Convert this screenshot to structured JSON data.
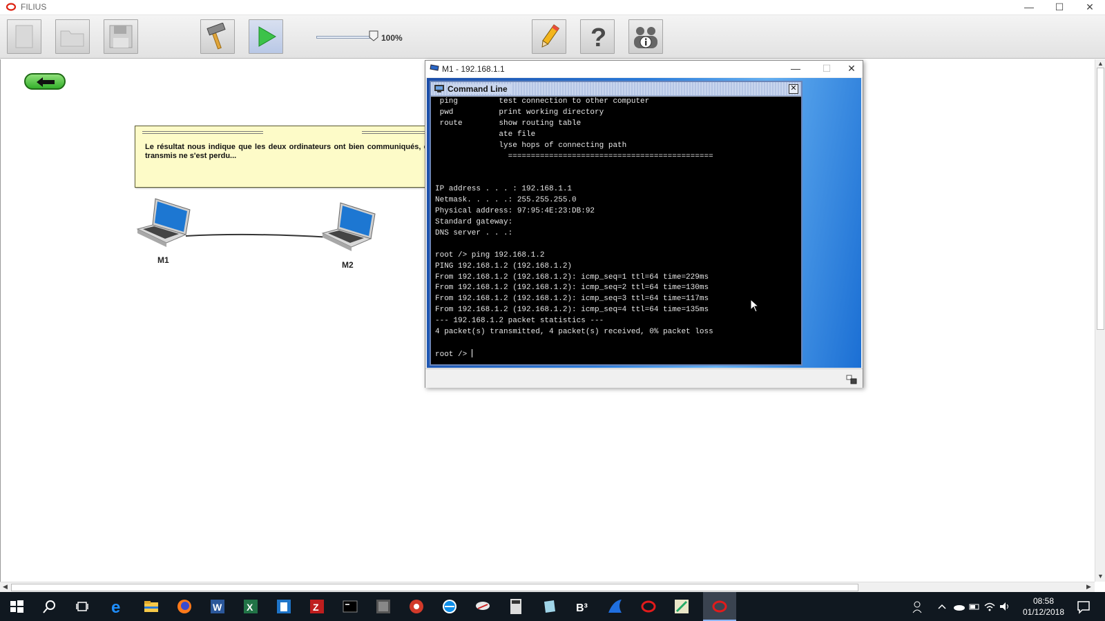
{
  "app": {
    "title": "FILIUS",
    "window_controls": {
      "minimize": "—",
      "maximize": "☐",
      "close": "✕"
    }
  },
  "toolbar": {
    "buttons": [
      "new-file-icon",
      "open-folder-icon",
      "save-disk-icon",
      "hammer-design-icon",
      "play-simulation-icon",
      "pencil-documentation-icon",
      "help-question-icon",
      "about-info-icon"
    ],
    "zoom_label": "100%",
    "zoom_fraction": 1.0
  },
  "canvas": {
    "tooltip": "Le résultat nous indique que les deux ordinateurs ont bien communiqués, et qu'aucun des paquets transmis ne s'est perdu...",
    "nodes": [
      {
        "label": "M1"
      },
      {
        "label": "M2"
      }
    ]
  },
  "terminal_window": {
    "title": "M1 - 192.168.1.1",
    "panel_title": "Command Line",
    "lines": [
      " ping         test connection to other computer",
      " pwd          print working directory",
      " route        show routing table",
      "              ate file",
      "              lyse hops of connecting path",
      "                =============================================",
      "",
      "",
      "IP address . . . : 192.168.1.1",
      "Netmask. . . . .: 255.255.255.0",
      "Physical address: 97:95:4E:23:DB:92",
      "Standard gateway:",
      "DNS server . . .:",
      "",
      "root /> ping 192.168.1.2",
      "PING 192.168.1.2 (192.168.1.2)",
      "From 192.168.1.2 (192.168.1.2): icmp_seq=1 ttl=64 time=229ms",
      "From 192.168.1.2 (192.168.1.2): icmp_seq=2 ttl=64 time=130ms",
      "From 192.168.1.2 (192.168.1.2): icmp_seq=3 ttl=64 time=117ms",
      "From 192.168.1.2 (192.168.1.2): icmp_seq=4 ttl=64 time=135ms",
      "--- 192.168.1.2 packet statistics ---",
      "4 packet(s) transmitted, 4 packet(s) received, 0% packet loss",
      ""
    ],
    "prompt": "root /> "
  },
  "taskbar": {
    "apps": [
      "windows-start-icon",
      "search-icon",
      "task-view-icon",
      "edge-icon",
      "file-explorer-icon",
      "firefox-icon",
      "word-icon",
      "excel-icon",
      "notepad-plus-icon",
      "filezilla-icon",
      "cmd-icon",
      "tex-icon",
      "paint-icon",
      "teamviewer-icon",
      "cisco-icon",
      "calculator-icon",
      "bucket-icon",
      "b3-icon",
      "shark-icon",
      "filius-icon",
      "paint-brush-icon",
      "filius-active-icon"
    ],
    "time": "08:58",
    "date": "01/12/2018"
  },
  "colors": {
    "tooltip_bg": "#fdfbc8",
    "terminal_bg": "#000000",
    "terminal_fg": "#e6e6e6",
    "taskbar_bg": "#101820"
  }
}
